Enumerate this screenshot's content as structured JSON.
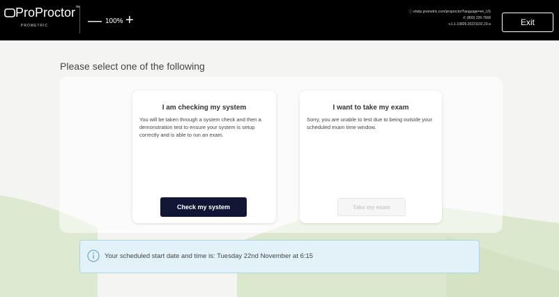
{
  "header": {
    "logo_text": "ProProctor",
    "logo_tm": "™",
    "logo_sub": "PROMETRIC",
    "zoom_out": "—",
    "zoom_level": "100%",
    "zoom_in": "+",
    "sysinfo_line1": "ⓘ ehelp.prometric.com/proproctor?language=en_US",
    "sysinfo_line2": "✆ (800) 226-7668",
    "sysinfo_line3": "v.1.1.10829.20221102.23-a",
    "exit_label": "Exit"
  },
  "main": {
    "heading": "Please select one of the following",
    "cards": [
      {
        "title": "I am checking my system",
        "body": "You will be taken through a system check and then a demonstration test to ensure your system is setup correctly and is able to run an exam.",
        "button": "Check my system"
      },
      {
        "title": "I want to take my exam",
        "body": "Sorry, you are unable to test due to being outside your scheduled exam time window.",
        "button": "Take my exam"
      }
    ],
    "banner_text": "Your scheduled start date and time is: Tuesday 22nd November at 6:15"
  },
  "colors": {
    "topbar": "#000000",
    "primary_button": "#101633",
    "banner_bg": "#e3f1f8",
    "banner_border": "#aed5e6",
    "wave_green": "#d8e7c9"
  }
}
